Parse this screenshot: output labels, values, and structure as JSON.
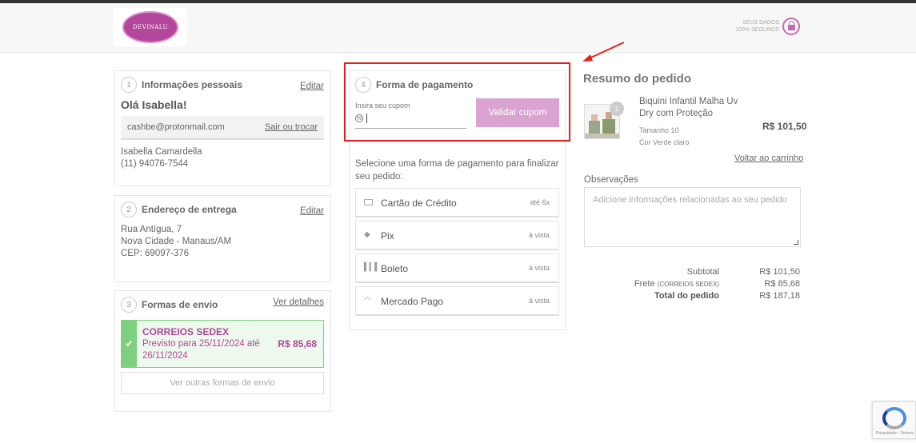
{
  "header": {
    "logo_text": "DEVINALU",
    "secure_line1": "SEUS DADOS",
    "secure_line2": "100% SEGUROS"
  },
  "personal": {
    "step": "1",
    "title": "Informações pessoais",
    "edit": "Editar",
    "greeting": "Olá Isabella!",
    "email": "cashbe@protonmail.com",
    "switch": "Sair ou trocar",
    "name": "Isabella Camardella",
    "phone": "(11) 94076-7544"
  },
  "address": {
    "step": "2",
    "title": "Endereço de entrega",
    "edit": "Editar",
    "line1": "Rua Antígua, 7",
    "line2": "Nova Cidade - Manaus/AM",
    "line3": "CEP: 69097-376"
  },
  "shipping": {
    "step": "3",
    "title": "Formas de envio",
    "details": "Ver detalhes",
    "option_name": "CORREIOS SEDEX",
    "option_desc": "Previsto para 25/11/2024 até 26/11/2024",
    "option_price": "R$ 85,68",
    "other": "Ver outras formas de envio"
  },
  "payment": {
    "step": "4",
    "title": "Forma de pagamento",
    "coupon_label": "Insira seu cupom",
    "coupon_value": "",
    "validate": "Validar cupom",
    "intro": "Selecione uma forma de pagamento para finalizar seu pedido:",
    "options": [
      {
        "name": "Cartão de Crédito",
        "note": "até 6x",
        "icon": "credit-card-icon"
      },
      {
        "name": "Pix",
        "note": "à vista",
        "icon": "pix-icon"
      },
      {
        "name": "Boleto",
        "note": "à vista",
        "icon": "barcode-icon"
      },
      {
        "name": "Mercado Pago",
        "note": "à vista",
        "icon": "mercado-pago-icon"
      }
    ]
  },
  "summary": {
    "title": "Resumo do pedido",
    "qty": "1",
    "product_name": "Biquini Infantil Malha Uv Dry com Proteção",
    "product_size": "Tamanho 10",
    "product_color": "Cor Verde claro",
    "product_price": "R$ 101,50",
    "back_to_cart": "Voltar ao carrinho",
    "obs_label": "Observações",
    "obs_placeholder": "Adicione informações relacionadas ao seu pedido",
    "subtotal_label": "Subtotal",
    "subtotal_value": "R$ 101,50",
    "frete_label": "Frete",
    "frete_note": "(CORREIOS SEDEX)",
    "frete_value": "R$ 85,68",
    "total_label": "Total do pedido",
    "total_value": "R$ 187,18"
  },
  "recaptcha": {
    "footer": "Privacidade - Termos"
  },
  "colors": {
    "brand": "#b2479b",
    "button": "#dba3d2",
    "success": "#7ecf7e",
    "highlight": "#e02020"
  }
}
